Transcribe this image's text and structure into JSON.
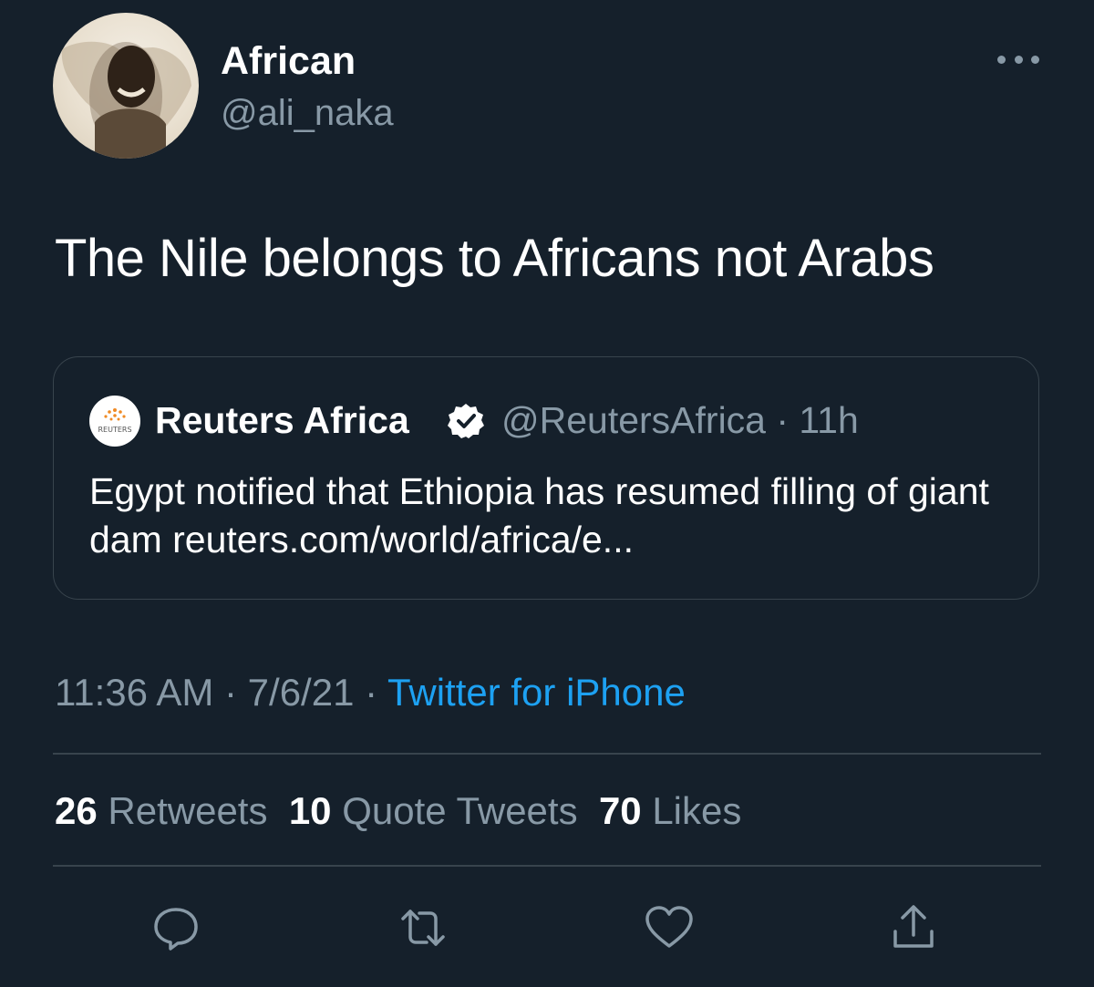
{
  "author": {
    "name": "African",
    "handle": "@ali_naka"
  },
  "tweet": {
    "text": "The Nile belongs to Africans not Arabs"
  },
  "quoted": {
    "name": "Reuters Africa",
    "handle": "@ReutersAfrica",
    "time": "11h",
    "text": "Egypt notified that Ethiopia has resumed filling of giant dam reuters.com/world/africa/e...",
    "logo_text": "REUTERS"
  },
  "meta": {
    "time": "11:36 AM",
    "date": "7/6/21",
    "source": "Twitter for iPhone"
  },
  "stats": {
    "retweets_count": "26",
    "retweets_label": "Retweets",
    "quotes_count": "10",
    "quotes_label": "Quote Tweets",
    "likes_count": "70",
    "likes_label": "Likes"
  },
  "icons": {
    "reply": "reply-icon",
    "retweet": "retweet-icon",
    "like": "heart-icon",
    "share": "share-icon",
    "more": "more-icon",
    "verified": "verified-badge-icon"
  },
  "colors": {
    "background": "#15202b",
    "muted": "#8899a6",
    "link": "#1da1f2",
    "border": "#38444d"
  }
}
